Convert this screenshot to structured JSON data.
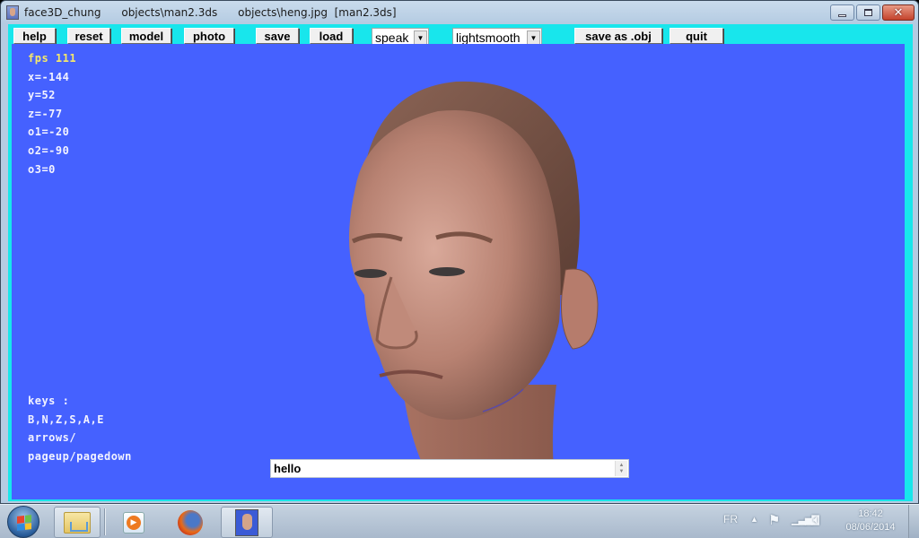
{
  "window": {
    "title": "face3D_chung      objects\\man2.3ds      objects\\heng.jpg  [man2.3ds]",
    "controls": {
      "minimize": "minimize",
      "maximize": "maximize",
      "close": "✕"
    }
  },
  "toolbar": {
    "buttons": [
      {
        "id": "help",
        "label": "help"
      },
      {
        "id": "reset",
        "label": "reset"
      },
      {
        "id": "model",
        "label": "model"
      },
      {
        "id": "photo",
        "label": "photo"
      },
      {
        "id": "save",
        "label": "save"
      },
      {
        "id": "load",
        "label": "load"
      },
      {
        "id": "save-obj",
        "label": "save as .obj"
      },
      {
        "id": "quit",
        "label": "quit"
      }
    ],
    "selects": [
      {
        "id": "speak",
        "value": "speak"
      },
      {
        "id": "lighting",
        "value": "lightsmooth"
      }
    ]
  },
  "hud": {
    "fps": "fps 111",
    "x": "x=-144",
    "y": "y=52",
    "z": "z=-77",
    "o1": "o1=-20",
    "o2": "o2=-90",
    "o3": "o3=0"
  },
  "keys_help": {
    "title": "keys :",
    "line1": "B,N,Z,S,A,E",
    "line2": "arrows/",
    "line3": "pageup/pagedown"
  },
  "speech_input": {
    "value": "hello"
  },
  "viewport": {
    "background": "#4561ff",
    "model": "3D textured male head"
  },
  "taskbar": {
    "items": [
      "start",
      "windows-explorer",
      "windows-media-player",
      "firefox",
      "face3D_chung"
    ],
    "tray": {
      "language": "FR",
      "time": "18:42",
      "date": "08/06/2014"
    }
  },
  "colors": {
    "client_frame": "#18e6ec",
    "viewport": "#4561ff",
    "fps_text": "#f6e86a",
    "hud_text": "#f2f2ff"
  }
}
